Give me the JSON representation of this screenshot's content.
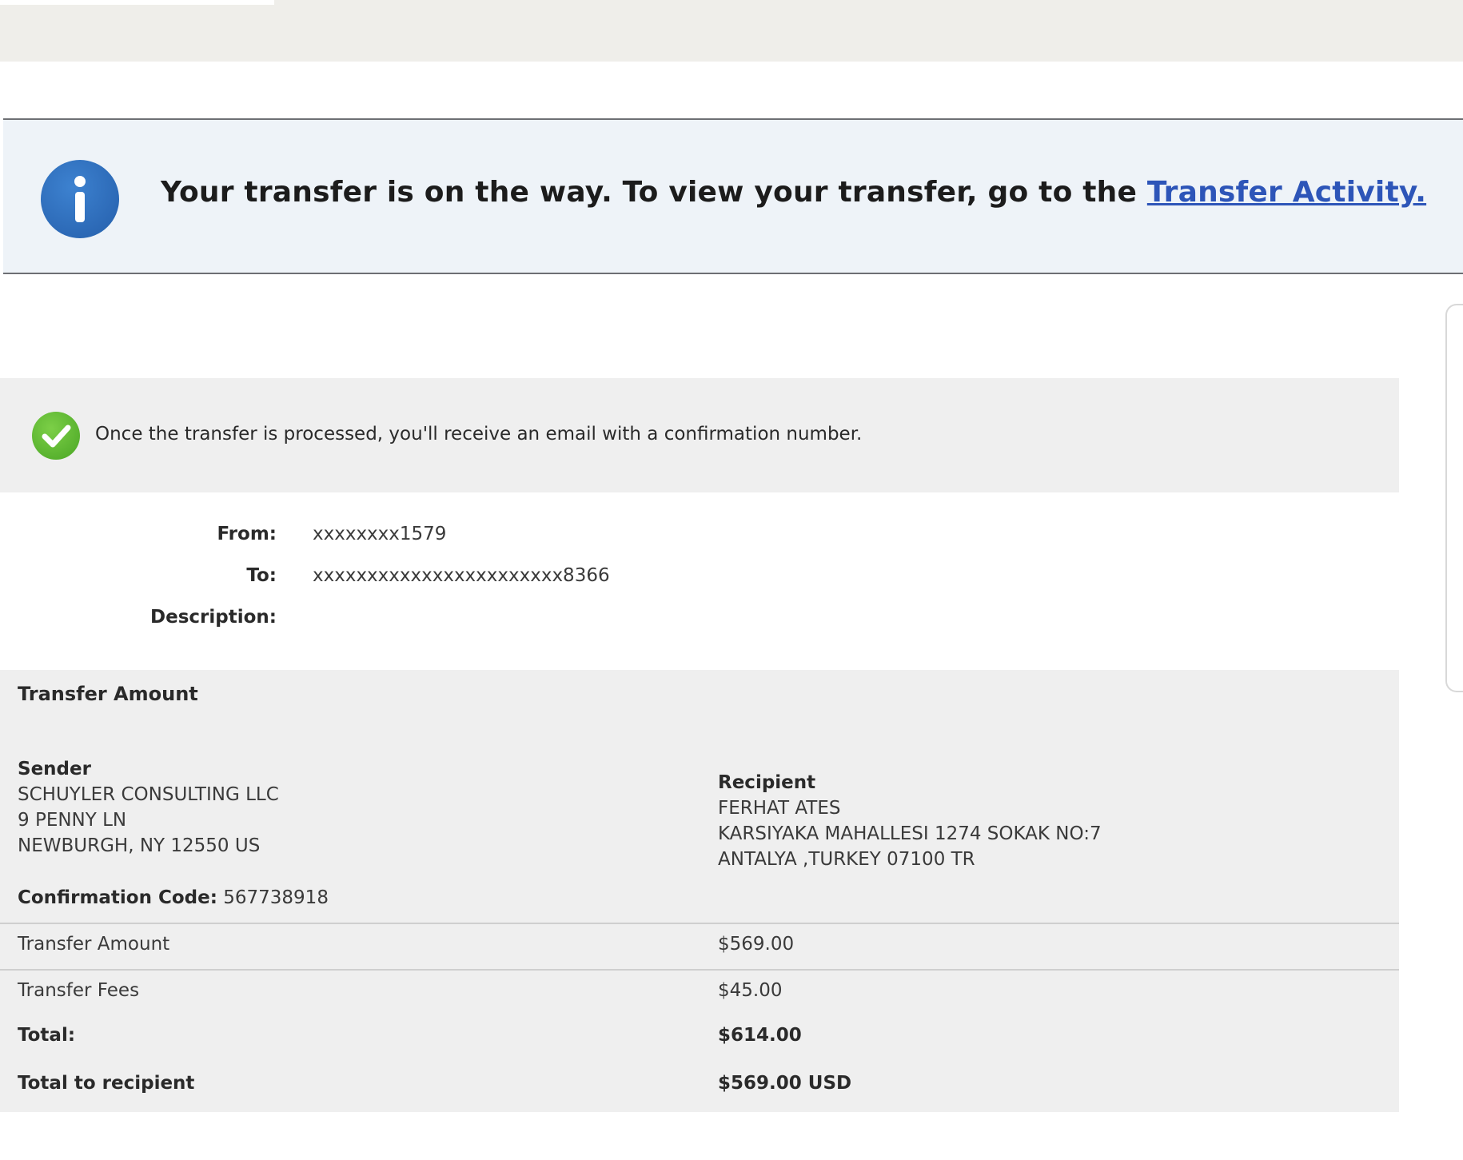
{
  "banner": {
    "message": "Your transfer is on the way. To view your transfer, go to the ",
    "link_label": "Transfer Activity.",
    "icon": "info-icon"
  },
  "notice": {
    "icon": "checkmark-icon",
    "text": "Once the transfer is processed, you'll receive an email with a confirmation number."
  },
  "details": {
    "from_label": "From:",
    "from_value": "xxxxxxxx1579",
    "to_label": "To:",
    "to_value": "xxxxxxxxxxxxxxxxxxxxxxx8366",
    "description_label": "Description:",
    "description_value": ""
  },
  "amount_section": {
    "title": "Transfer Amount",
    "sender": {
      "heading": "Sender",
      "name": "SCHUYLER CONSULTING LLC",
      "address1": "9 PENNY LN",
      "address2": "NEWBURGH, NY 12550 US"
    },
    "recipient": {
      "heading": "Recipient",
      "name": "FERHAT ATES",
      "address1": "KARSIYAKA MAHALLESI 1274 SOKAK NO:7",
      "address2": "ANTALYA ,TURKEY 07100 TR"
    },
    "confirmation_label": "Confirmation Code:",
    "confirmation_value": " 567738918",
    "rows": [
      {
        "label": "Transfer Amount",
        "value": "$569.00"
      },
      {
        "label": "Transfer Fees",
        "value": "$45.00"
      },
      {
        "label": "Total:",
        "value": "$614.00"
      },
      {
        "label": "Total to recipient",
        "value": "$569.00 USD"
      }
    ]
  },
  "colors": {
    "link": "#2d55b8",
    "banner_bg": "#eef3f8",
    "section_bg": "#efefef",
    "info_icon": "#2c69b6",
    "check_icon": "#56b02d"
  }
}
